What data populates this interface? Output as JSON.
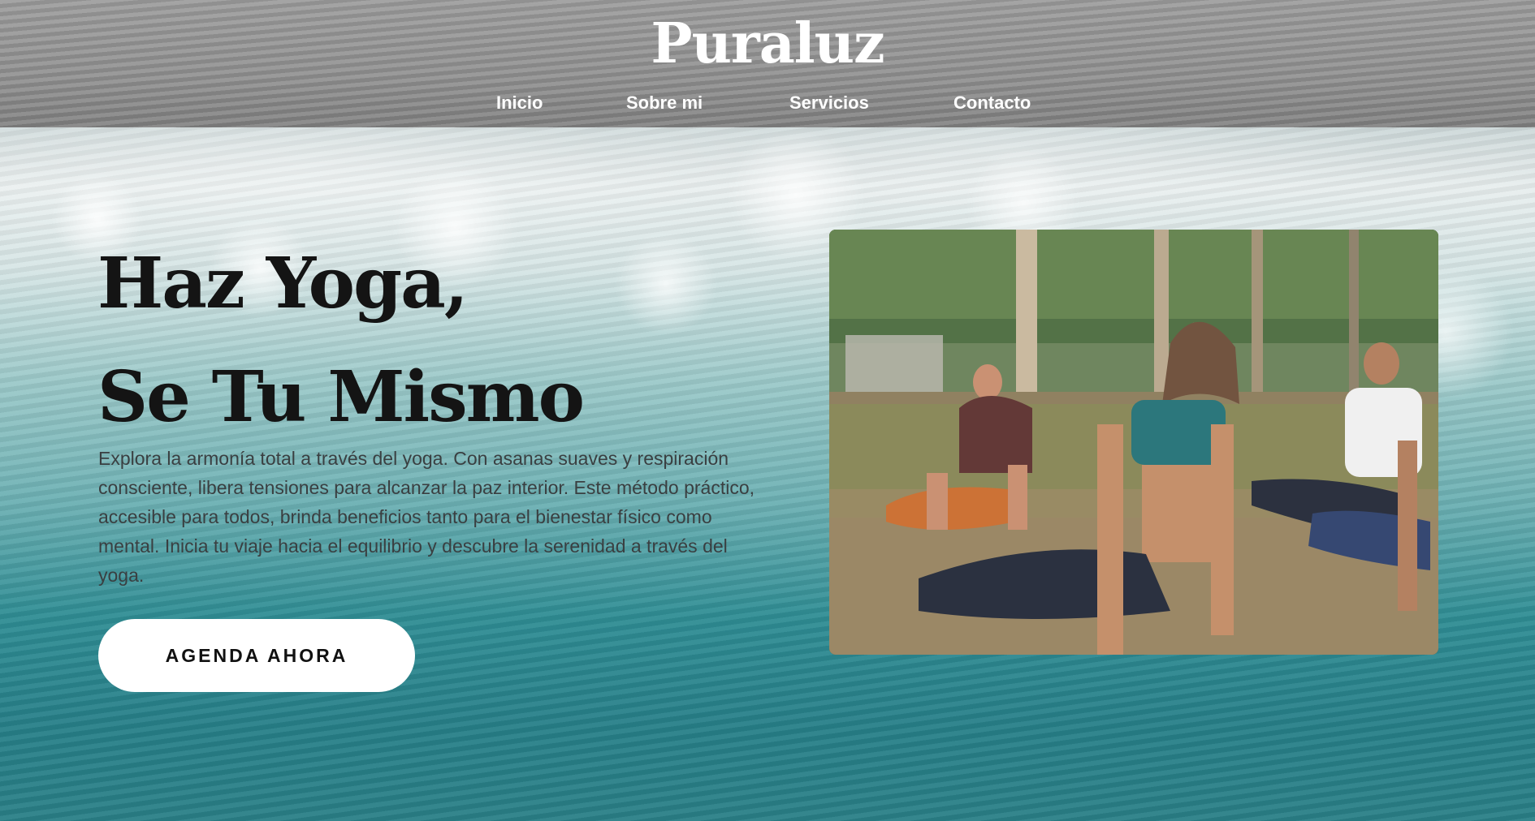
{
  "site": {
    "brand": "Puraluz"
  },
  "nav": {
    "items": [
      {
        "label": "Inicio"
      },
      {
        "label": "Sobre mi"
      },
      {
        "label": "Servicios"
      },
      {
        "label": "Contacto"
      }
    ]
  },
  "hero": {
    "title_line1": "Haz Yoga,",
    "title_line2": "Se Tu Mismo",
    "description": "Explora la armonía total a través del yoga. Con asanas suaves y respiración consciente, libera tensiones para alcanzar la paz interior. Este método práctico, accesible para todos, brinda beneficios tanto para el bienestar físico como mental. Inicia tu viaje hacia el equilibrio y descubre la serenidad a través del yoga.",
    "cta_label": "AGENDA AHORA"
  },
  "colors": {
    "header_overlay": "#8e8e8e",
    "ocean_teal": "#2f8d94",
    "title_text": "#141414",
    "cta_bg": "#ffffff"
  }
}
